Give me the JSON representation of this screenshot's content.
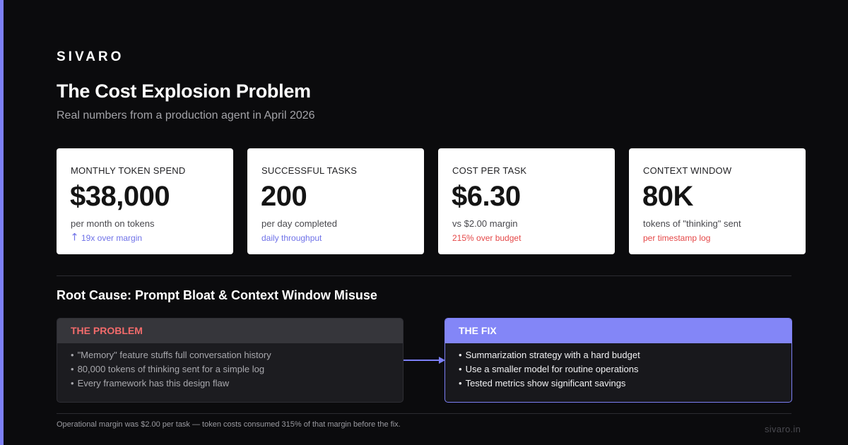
{
  "brand": "SIVARO",
  "title": "The Cost Explosion Problem",
  "subtitle": "Real numbers from a production agent in April 2026",
  "cards": [
    {
      "label": "MONTHLY TOKEN SPEND",
      "value": "$38,000",
      "desc": "per month on tokens",
      "note": "19x over margin",
      "note_icon": "arrow-up-icon",
      "note_color": "#6f72e8"
    },
    {
      "label": "SUCCESSFUL TASKS",
      "value": "200",
      "desc": "per day completed",
      "note": "daily throughput",
      "note_color": "#6f72e8"
    },
    {
      "label": "COST PER TASK",
      "value": "$6.30",
      "desc": "vs $2.00 margin",
      "note": "215% over budget",
      "note_color": "#e54848"
    },
    {
      "label": "CONTEXT WINDOW",
      "value": "80K",
      "desc": "tokens of \"thinking\" sent",
      "note": "per timestamp log",
      "note_color": "#e54848"
    }
  ],
  "section_title": "Root Cause: Prompt Bloat & Context Window Misuse",
  "problem": {
    "heading": "THE PROBLEM",
    "items": [
      "\"Memory\" feature stuffs full conversation history",
      "80,000 tokens of thinking sent for a simple log",
      "Every framework has this design flaw"
    ]
  },
  "fix": {
    "heading": "THE FIX",
    "items": [
      "Summarization strategy with a hard budget",
      "Use a smaller model for routine operations",
      "Tested metrics show significant savings"
    ]
  },
  "footer_note": "Operational margin was $2.00 per task — token costs consumed 315% of that margin before the fix.",
  "site": "sivaro.in",
  "colors": {
    "accent": "#7c7ff5",
    "problem_heading": "#f26b6b",
    "note_blue": "#6f72e8",
    "note_red": "#e54848"
  }
}
